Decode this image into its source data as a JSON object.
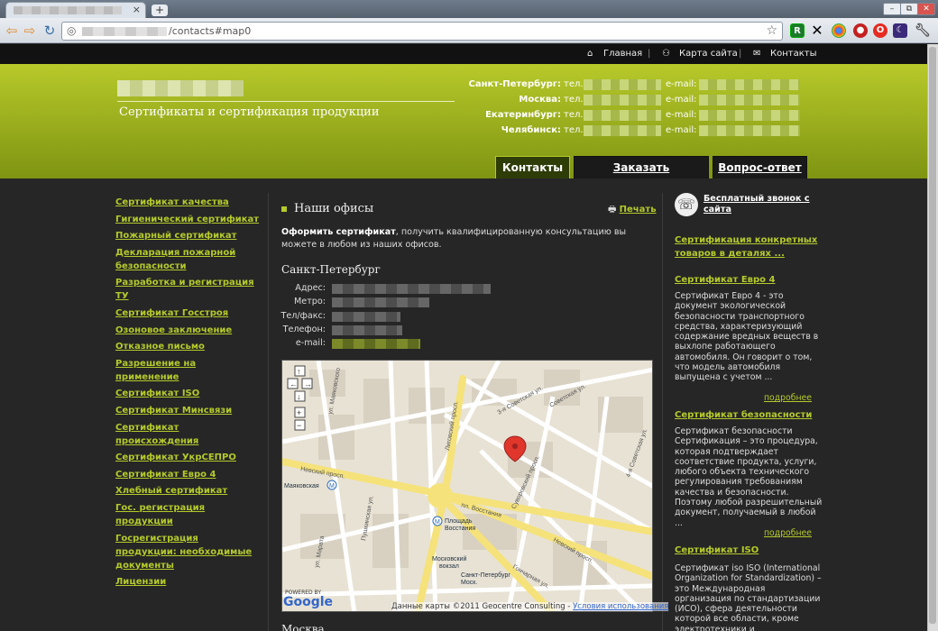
{
  "browser": {
    "tab_close": "×",
    "new_tab": "+",
    "url_suffix": "/contacts#map0",
    "window_buttons": [
      "–",
      "⧉",
      "✕"
    ]
  },
  "topnav": {
    "home": "Главная",
    "sitemap": "Карта сайта",
    "contacts": "Контакты"
  },
  "header": {
    "tagline": "Сертификаты и сертификация продукции",
    "offices": [
      {
        "city": "Санкт-Петербург:",
        "tel": "тел.",
        "email": "e-mail:"
      },
      {
        "city": "Москва:",
        "tel": "тел.",
        "email": "e-mail:"
      },
      {
        "city": "Екатеринбург:",
        "tel": "тел.",
        "email": "e-mail:"
      },
      {
        "city": "Челябинск:",
        "tel": "тел.",
        "email": "e-mail:"
      }
    ]
  },
  "tabs": [
    "Контакты",
    "Заказать сертификат",
    "Вопрос-ответ"
  ],
  "sidebar": {
    "items": [
      "Сертификат качества",
      "Гигиенический сертификат",
      "Пожарный сертификат",
      "Декларация пожарной безопасности",
      "Разработка и регистрация ТУ",
      "Сертификат Госстроя",
      "Озоновое заключение",
      "Отказное письмо",
      "Разрешение на применение",
      "Сертификат ISO",
      "Сертификат Минсвязи",
      "Сертификат происхождения",
      "Сертификат УкрСЕПРО",
      "Сертификат Евро 4",
      "Хлебный сертификат",
      "Гос. регистрация продукции",
      "Госрегистрация продукции: необходимые документы",
      "Лицензии"
    ]
  },
  "main": {
    "heading": "Наши офисы",
    "print": "Печать",
    "intro_bold": "Оформить сертификат",
    "intro_rest": ", получить квалифицированную консультацию вы можете в любом из наших офисов.",
    "city": "Санкт-Петербург",
    "fields": [
      "Адрес:",
      "Метро:",
      "Тел/факс:",
      "Телефон:",
      "e-mail:"
    ],
    "map": {
      "streets": [
        "Невский просп.",
        "Лиговский просп.",
        "пл. Восстания",
        "Гончарная ул.",
        "Суворовский просп.",
        "Советская ул.",
        "2-я Советская ул.",
        "3-я Советская ул.",
        "4-я Советская ул.",
        "ул. Маяковского",
        "ул. Марата",
        "Пушкинская ул.",
        "Невский просп.",
        "Греческий просп."
      ],
      "stations": [
        "Маяковская",
        "Площадь Восстания",
        "Московский вокзал",
        "Санкт-Петербург Моск."
      ],
      "powered": "POWERED BY",
      "google": "Google",
      "footer": "Данные карты ©2011 Geocentre Consulting - ",
      "terms": "Условия использования"
    },
    "next_city": "Москва"
  },
  "right": {
    "callback": "Бесплатный звонок с сайта",
    "promo": "Сертификация конкретных товаров в деталях ...",
    "blocks": [
      {
        "title": "Сертификат Евро 4",
        "text": "Сертификат Евро 4 - это документ экологической безопасности транспортного средства, характеризующий содержание вредных веществ в выхлопе работающего автомобиля. Он говорит о том, что модель автомобиля выпущена с учетом ...",
        "more": "подробнее"
      },
      {
        "title": "Сертификат безопасности",
        "text": "Сертификат безопасности Сертификация – это процедура, которая подтверждает соответствие продукта, услуги, любого объекта технического регулирования требованиям качества и безопасности. Поэтому любой разрешительный документ, получаемый в любой ...",
        "more": "подробнее"
      },
      {
        "title": "Сертификат ISO",
        "text": "Сертификат iso ISO (International Organization for Standardization) – это Международная организация по стандартизации (ИСО), сфера деятельности которой все области, кроме электротехники и",
        "more": ""
      }
    ]
  }
}
